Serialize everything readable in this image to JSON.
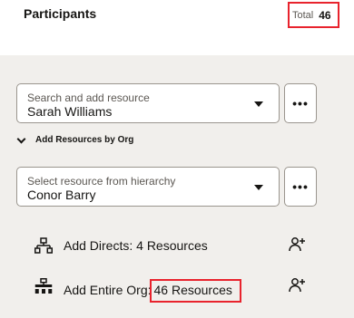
{
  "header": {
    "title": "Participants",
    "total_label": "Total",
    "total_count": "46"
  },
  "resource_search": {
    "label": "Search and add resource",
    "value": "Sarah Williams",
    "more_label": "•••"
  },
  "org_section": {
    "toggle_label": "Add Resources by Org"
  },
  "hierarchy_select": {
    "label": "Select resource from hierarchy",
    "value": "Conor Barry",
    "more_label": "•••"
  },
  "actions": {
    "add_directs": "Add Directs: 4 Resources",
    "add_entire_org_prefix": "Add Entire Org:",
    "add_entire_org_count": "46 Resources"
  },
  "icons": {
    "directs": "hierarchy-icon",
    "entire_org": "org-chart-icon",
    "add": "add-person-icon"
  }
}
